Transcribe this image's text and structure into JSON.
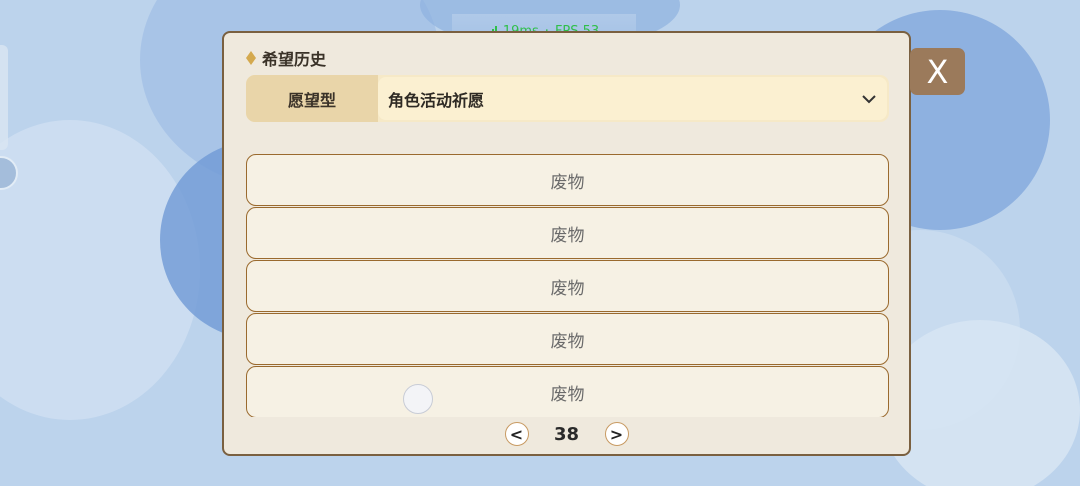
{
  "status": {
    "ping": "19ms",
    "separator": "·",
    "fps": "FPS 53"
  },
  "dialog": {
    "title": "希望历史",
    "close_label": "X",
    "wish_type_label": "愿望型",
    "wish_type_value": "角色活动祈愿",
    "items": [
      "废物",
      "废物",
      "废物",
      "废物",
      "废物"
    ],
    "pager": {
      "prev": "<",
      "page": "38",
      "next": ">"
    }
  },
  "colors": {
    "panel_bg": "#efe9dd",
    "panel_border": "#7a6040",
    "close_bg": "#9b7a5b",
    "item_border": "#9a6a2e",
    "status_green": "#2fbf4a"
  },
  "icons": [
    "signal-icon",
    "diamond-icon",
    "chevron-down-icon",
    "close-icon"
  ]
}
